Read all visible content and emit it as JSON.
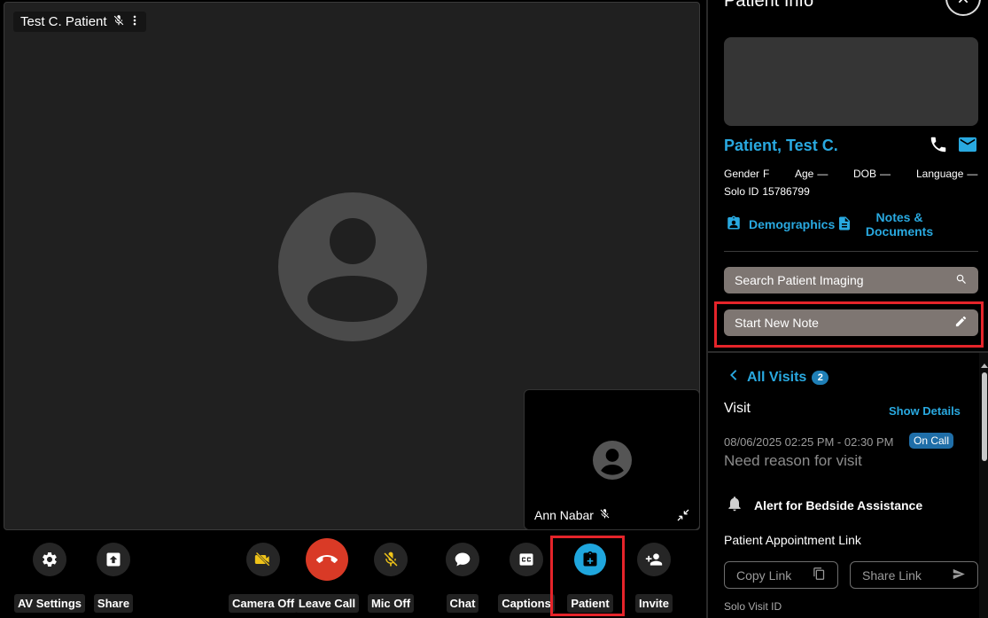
{
  "main_video": {
    "participant_name": "Test C. Patient"
  },
  "self_view": {
    "participant_name": "Ann Nabar"
  },
  "toolbar": {
    "av_settings": "AV Settings",
    "share": "Share",
    "camera_off": "Camera Off",
    "leave_call": "Leave Call",
    "mic_off": "Mic Off",
    "chat": "Chat",
    "captions": "Captions",
    "patient": "Patient",
    "invite": "Invite"
  },
  "panel": {
    "title": "Patient Info",
    "patient_name": "Patient, Test C.",
    "fields": {
      "gender_label": "Gender",
      "gender_value": "F",
      "age_label": "Age",
      "age_value": "—",
      "dob_label": "DOB",
      "dob_value": "—",
      "language_label": "Language",
      "language_value": "—",
      "solo_id_label": "Solo ID",
      "solo_id_value": "15786799"
    },
    "demographics_label": "Demographics",
    "notes_documents_label": "Notes & Documents",
    "search_imaging_label": "Search Patient Imaging",
    "start_note_label": "Start New Note",
    "all_visits_label": "All Visits",
    "all_visits_count": "2",
    "visit_heading": "Visit",
    "show_details_label": "Show Details",
    "visit_time": "08/06/2025 02:25 PM - 02:30 PM",
    "visit_status": "On Call",
    "visit_reason": "Need reason for visit",
    "alert_label": "Alert for Bedside Assistance",
    "appointment_link_label": "Patient Appointment Link",
    "copy_link_label": "Copy Link",
    "share_link_label": "Share Link",
    "solo_visit_id_label": "Solo Visit ID"
  },
  "colors": {
    "accent": "#29a9e0",
    "leave_call": "#d93a26",
    "highlight": "#e5242a",
    "pill_button": "#7e7672"
  },
  "icons": [
    "mic-off-icon",
    "more-vert-icon",
    "avatar-icon",
    "collapse-icon",
    "gear-icon",
    "share-screen-icon",
    "camera-off-icon",
    "phone-hangup-icon",
    "chat-icon",
    "captions-icon",
    "clipboard-plus-icon",
    "person-add-icon",
    "close-icon",
    "phone-icon",
    "mail-icon",
    "badge-icon",
    "document-icon",
    "search-icon",
    "pencil-icon",
    "chevron-left-icon",
    "bell-icon",
    "copy-icon",
    "send-icon"
  ]
}
